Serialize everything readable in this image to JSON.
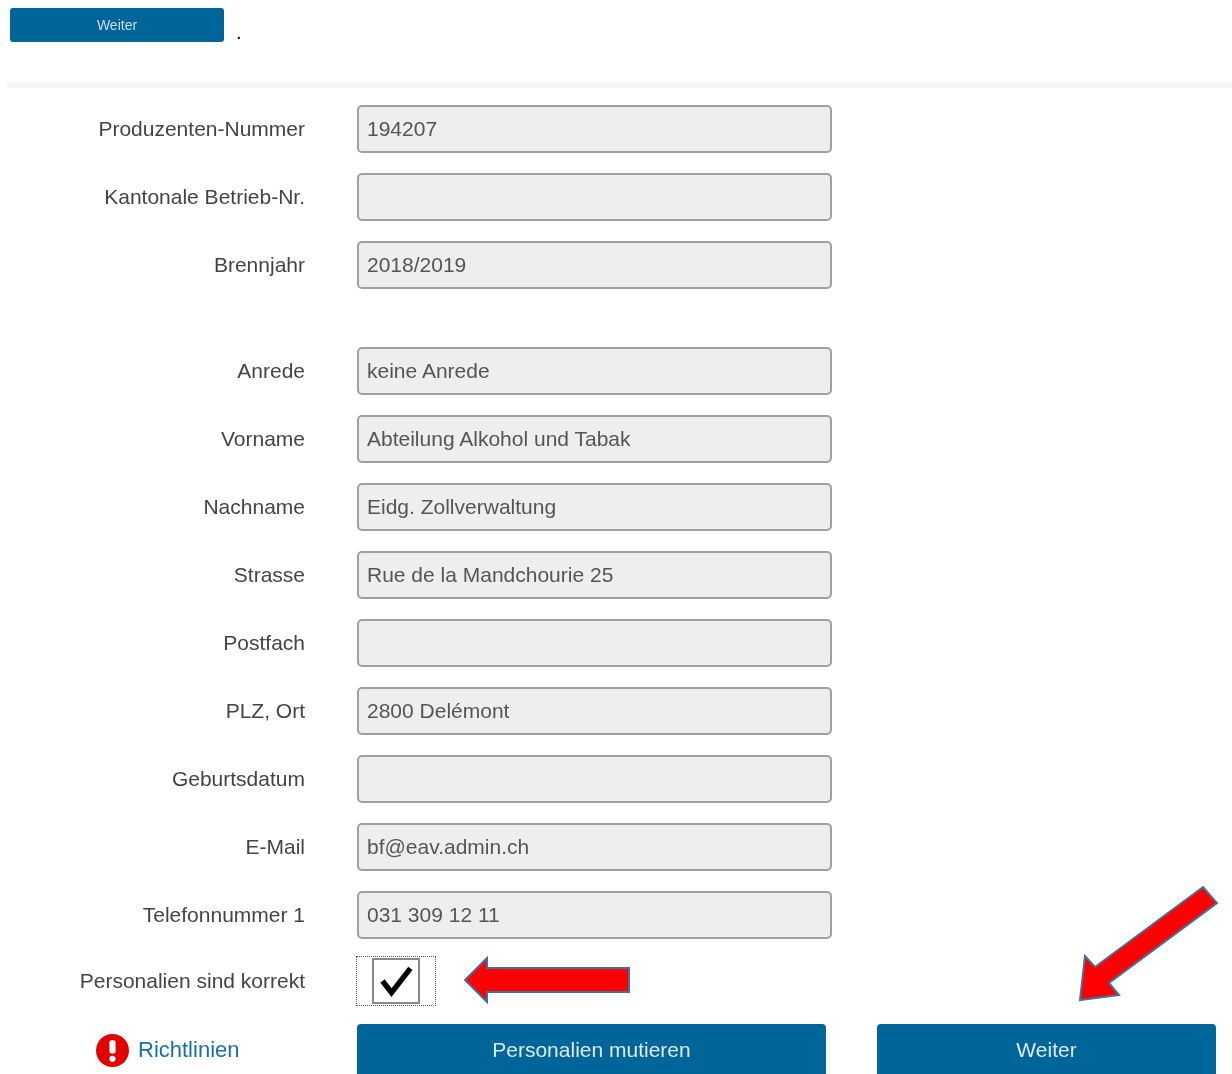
{
  "top_button": {
    "label": "Weiter"
  },
  "top_mark": ".",
  "field_groups": [
    [
      {
        "label": "Produzenten-Nummer",
        "value": "194207"
      },
      {
        "label": "Kantonale Betrieb-Nr."
      },
      {
        "label": "Brennjahr",
        "value": "2018/2019"
      }
    ],
    [
      {
        "label": "Anrede",
        "value": "keine Anrede"
      },
      {
        "label": "Vorname",
        "value": "Abteilung Alkohol und Tabak"
      },
      {
        "label": "Nachname",
        "value": "Eidg. Zollverwaltung"
      },
      {
        "label": "Strasse",
        "value": "Rue de la Mandchourie 25"
      },
      {
        "label": "Postfach"
      },
      {
        "label": "PLZ, Ort",
        "value": "2800 Delémont"
      },
      {
        "label": "Geburtsdatum"
      },
      {
        "label": "E-Mail",
        "value": "bf@eav.admin.ch"
      },
      {
        "label": "Telefonnummer 1",
        "value": "031 309 12 11"
      }
    ]
  ],
  "confirm": {
    "label": "Personalien sind korrekt",
    "checked": true
  },
  "guidelines_link": "Richtlinien",
  "buttons": [
    "Personalien mutieren",
    "Weiter"
  ]
}
